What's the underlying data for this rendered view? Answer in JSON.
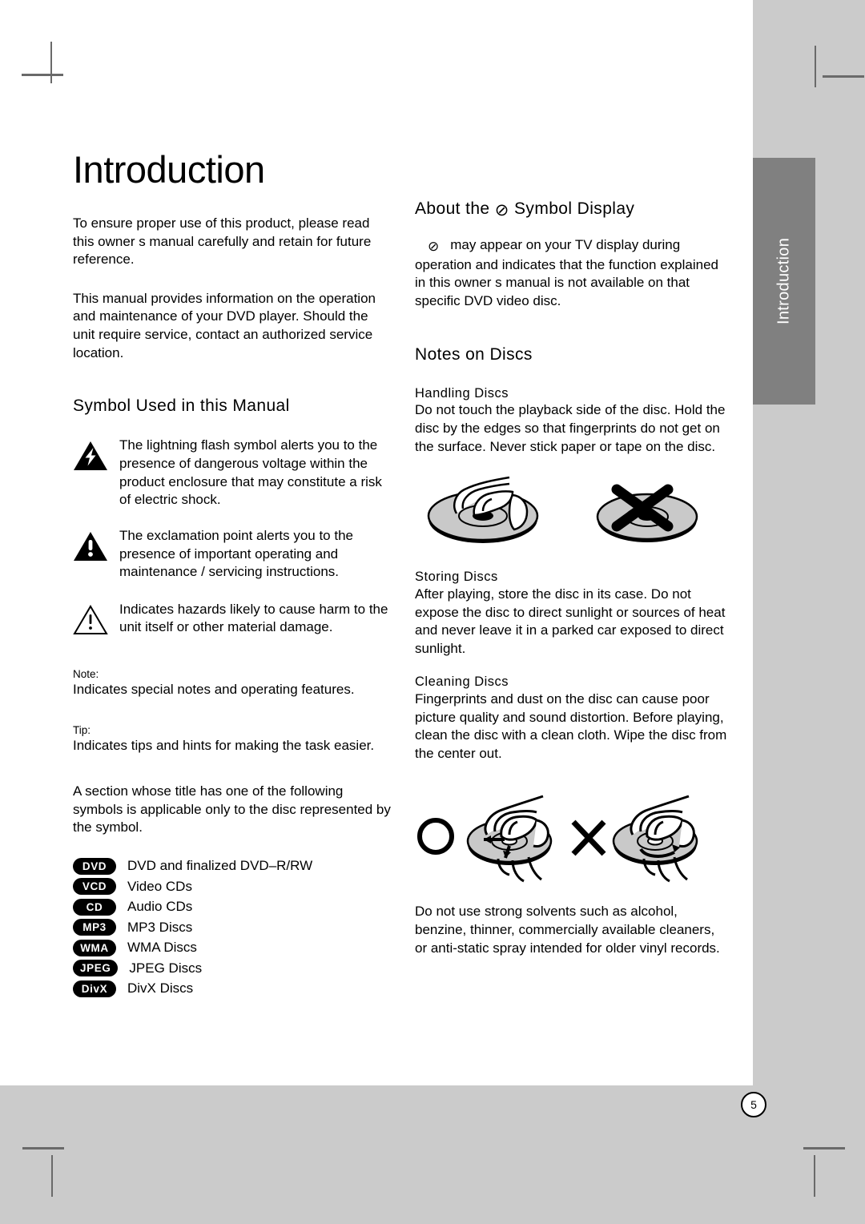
{
  "page": {
    "number": "5",
    "sidebar_tab_label": "Introduction",
    "title": "Introduction"
  },
  "left_column": {
    "intro_paragraph_1": "To ensure proper use of this product, please read this owner s manual carefully and retain for future reference.",
    "intro_paragraph_2": "This manual provides information on the operation and maintenance of your DVD player. Should the unit require service, contact an authorized service location.",
    "symbol_section": {
      "heading": "Symbol Used in this Manual",
      "items": [
        {
          "icon": "lightning-bolt-triangle-icon",
          "text": "The lightning flash symbol alerts you to the presence of dangerous voltage within the product enclosure that may constitute a risk of electric shock."
        },
        {
          "icon": "exclamation-triangle-filled-icon",
          "text": "The exclamation point alerts you to the presence of important operating and maintenance / servicing instructions."
        },
        {
          "icon": "exclamation-triangle-outline-icon",
          "text": "Indicates hazards likely to cause harm to the unit itself or other material damage."
        }
      ],
      "note_label": "Note:",
      "note_text": "Indicates special notes and operating features.",
      "tip_label": "Tip:",
      "tip_text": "Indicates tips and hints for making the task easier.",
      "applicability_text": "A section whose title has one of the following symbols is applicable only to the disc represented by the symbol."
    },
    "disc_formats": [
      {
        "badge": "DVD",
        "label": "DVD and finalized DVD–R/RW"
      },
      {
        "badge": "VCD",
        "label": "Video CDs"
      },
      {
        "badge": "CD",
        "label": "Audio CDs"
      },
      {
        "badge": "MP3",
        "label": "MP3 Discs"
      },
      {
        "badge": "WMA",
        "label": "WMA Discs"
      },
      {
        "badge": "JPEG",
        "label": "JPEG Discs"
      },
      {
        "badge": "DivX",
        "label": "DivX Discs"
      }
    ]
  },
  "right_column": {
    "symbol_display": {
      "heading_before": "About the",
      "heading_symbol": "⊘",
      "heading_after": "Symbol Display",
      "body_symbol": "⊘",
      "body_text": "may appear on your TV display during operation and indicates that the function explained in this owner s manual is not available on that specific DVD video disc."
    },
    "notes_on_discs": {
      "heading": "Notes on Discs",
      "handling": {
        "subheading": "Handling Discs",
        "text": "Do not touch the playback side of the disc. Hold the disc by the edges so that fingerprints do not get on the surface. Never stick paper or tape on the disc."
      },
      "handling_illustration": {
        "correct": "disc-hold-by-edges-illustration",
        "incorrect": "disc-touch-surface-crossed-out-illustration"
      },
      "storing": {
        "subheading": "Storing Discs",
        "text": "After playing, store the disc in its case. Do not expose the disc to direct sunlight or sources of heat and never leave it in a parked car exposed to direct sunlight."
      },
      "cleaning": {
        "subheading": "Cleaning Discs",
        "text": "Fingerprints and dust on the disc can cause poor picture quality and sound distortion. Before playing, clean the disc with a clean cloth. Wipe the disc from the center out."
      },
      "cleaning_illustration": {
        "correct_mark": "circle-ok-mark",
        "correct": "wipe-disc-center-out-illustration",
        "incorrect_mark": "cross-x-mark",
        "incorrect": "wipe-disc-circular-illustration"
      },
      "solvents_text": "Do not use strong solvents such as alcohol, benzine, thinner, commercially available cleaners, or anti-static spray intended for older vinyl records."
    }
  }
}
